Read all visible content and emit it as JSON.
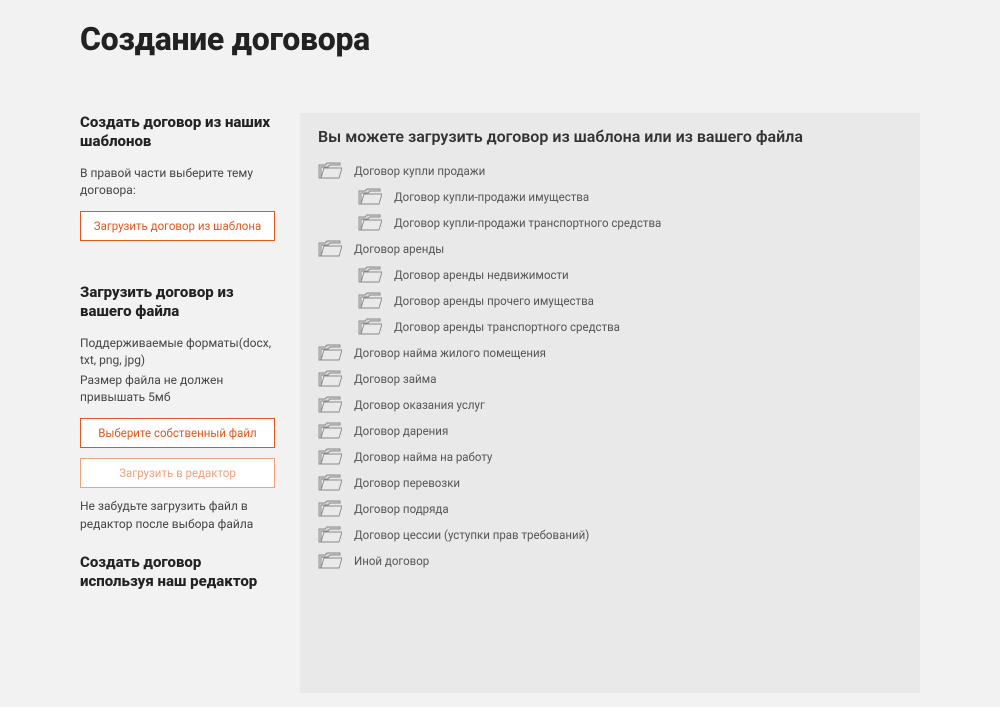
{
  "page": {
    "title": "Создание договора"
  },
  "sidebar": {
    "templates": {
      "heading": "Создать договор из наших шаблонов",
      "text": "В правой части выберите тему договора:",
      "button": "Загрузить договор из шаблона"
    },
    "upload": {
      "heading": "Загрузить договор из вашего файла",
      "line1": "Поддерживаемые форматы(docx, txt, png, jpg)",
      "line2": "Размер файла не должен привышать 5мб",
      "choose": "Выберите собственный файл",
      "load": "Загрузить в редактор",
      "note": "Не забудьте загрузить файл в редактор после выбора файла"
    },
    "editor": {
      "heading": "Создать договор используя наш редактор"
    }
  },
  "main": {
    "heading": "Вы можете загрузить договор из шаблона или из вашего файла",
    "tree": [
      {
        "label": "Договор купли продажи",
        "level": 0
      },
      {
        "label": "Договор купли-продажи имущества",
        "level": 1
      },
      {
        "label": "Договор купли-продажи транспортного средства",
        "level": 1
      },
      {
        "label": "Договор аренды",
        "level": 0
      },
      {
        "label": "Договор аренды недвижимости",
        "level": 1
      },
      {
        "label": "Договор аренды прочего имущества",
        "level": 1
      },
      {
        "label": "Договор аренды транспортного средства",
        "level": 1
      },
      {
        "label": "Договор найма жилого помещения",
        "level": 0
      },
      {
        "label": "Договор займа",
        "level": 0
      },
      {
        "label": "Договор оказания услуг",
        "level": 0
      },
      {
        "label": "Договор дарения",
        "level": 0
      },
      {
        "label": "Договор найма на работу",
        "level": 0
      },
      {
        "label": "Договор перевозки",
        "level": 0
      },
      {
        "label": "Договор подряда",
        "level": 0
      },
      {
        "label": "Договор цессии (уступки прав требований)",
        "level": 0
      },
      {
        "label": "Иной договор",
        "level": 0
      }
    ]
  }
}
